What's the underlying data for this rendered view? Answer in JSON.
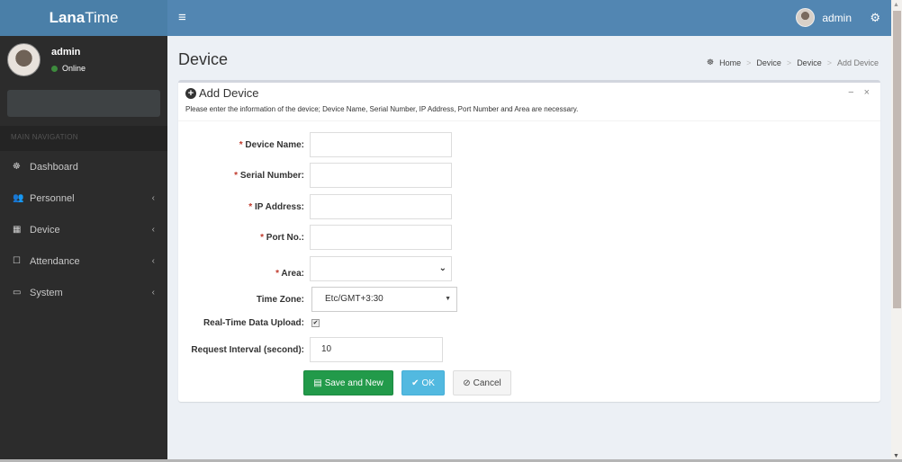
{
  "app": {
    "logo_bold": "Lana",
    "logo_rest": "Time"
  },
  "topbar": {
    "menu_icon": "hamburger-icon",
    "user_name": "admin",
    "settings_icon": "gears-icon"
  },
  "sidebar": {
    "user": {
      "name": "admin",
      "status": "Online",
      "status_color": "#3d8b3d"
    },
    "search_placeholder": "",
    "nav_header": "MAIN NAVIGATION",
    "items": [
      {
        "label": "Dashboard",
        "icon": "dashboard-icon",
        "glyph": "☸",
        "has_children": false
      },
      {
        "label": "Personnel",
        "icon": "users-icon",
        "glyph": "👥",
        "has_children": true
      },
      {
        "label": "Device",
        "icon": "building-icon",
        "glyph": "▦",
        "has_children": true
      },
      {
        "label": "Attendance",
        "icon": "sticky-note-icon",
        "glyph": "☐",
        "has_children": true
      },
      {
        "label": "System",
        "icon": "laptop-icon",
        "glyph": "⌨",
        "has_children": true
      }
    ]
  },
  "page": {
    "title": "Device",
    "breadcrumb": [
      "Home",
      "Device",
      "Device",
      "Add Device"
    ]
  },
  "box": {
    "title": "Add Device",
    "description": "Please enter the information of the device; Device Name, Serial Number, IP Address, Port Number and Area are necessary.",
    "collapse_symbol": "−",
    "close_symbol": "×"
  },
  "form": {
    "required_mark": "*",
    "device_name": {
      "label": "Device Name:",
      "value": ""
    },
    "serial_number": {
      "label": "Serial Number:",
      "value": ""
    },
    "ip_address": {
      "label": "IP Address:",
      "value": ""
    },
    "port_no": {
      "label": "Port No.:",
      "value": ""
    },
    "area": {
      "label": "Area:",
      "value": ""
    },
    "time_zone": {
      "label": "Time Zone:",
      "value": "Etc/GMT+3:30"
    },
    "realtime_upload": {
      "label": "Real-Time Data Upload:",
      "checked": true
    },
    "request_interval": {
      "label": "Request Interval (second):",
      "value": "10"
    }
  },
  "buttons": {
    "save_new": "Save and New",
    "ok": "OK",
    "cancel": "Cancel"
  },
  "colors": {
    "header": "#5286b2",
    "logo": "#4a7fa8",
    "sidebar": "#2c2c2c",
    "save": "#229a4a",
    "ok": "#52b9e0"
  }
}
